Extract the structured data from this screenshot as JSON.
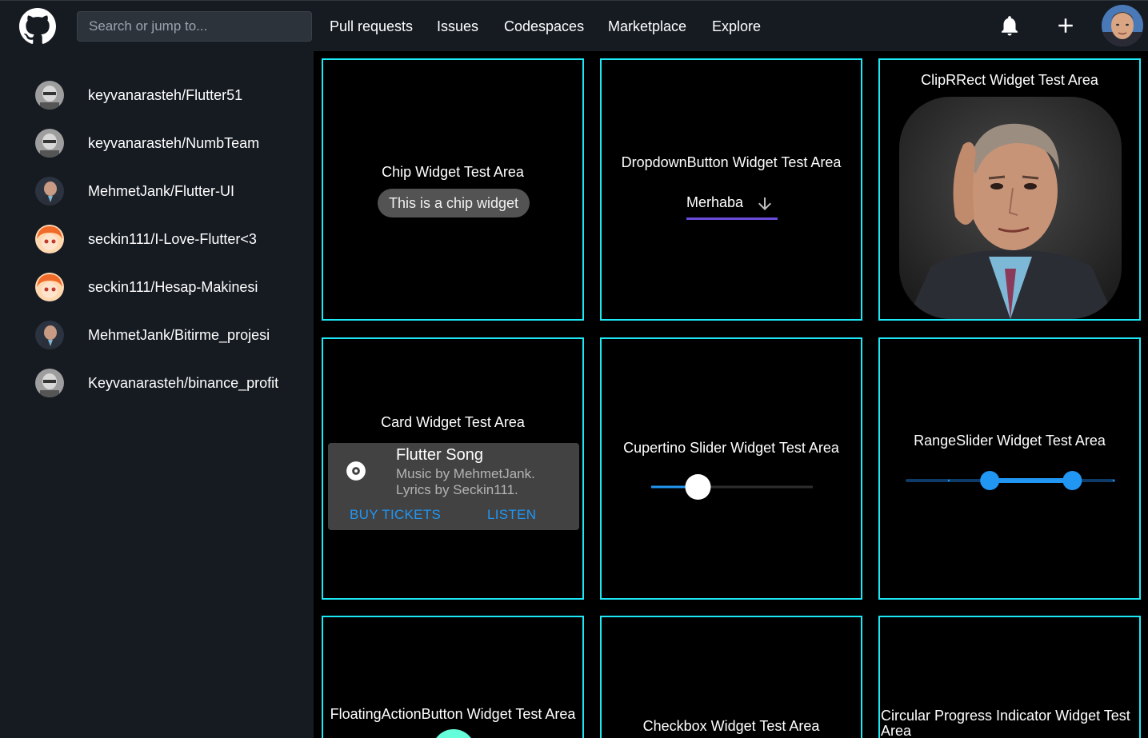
{
  "header": {
    "logo_icon": "github-octocat-icon",
    "search_placeholder": "Search or jump to...",
    "nav": [
      "Pull requests",
      "Issues",
      "Codespaces",
      "Marketplace",
      "Explore"
    ],
    "notification_icon": "bell-icon",
    "add_icon": "plus-icon",
    "avatar": "user-avatar"
  },
  "sidebar": {
    "repos": [
      {
        "name": "keyvanarasteh/Flutter51",
        "avatar": "avatar-grey"
      },
      {
        "name": "keyvanarasteh/NumbTeam",
        "avatar": "avatar-grey"
      },
      {
        "name": "MehmetJank/Flutter-UI",
        "avatar": "avatar-suit"
      },
      {
        "name": "seckin111/I-Love-Flutter<3",
        "avatar": "avatar-anime"
      },
      {
        "name": "seckin111/Hesap-Makinesi",
        "avatar": "avatar-anime"
      },
      {
        "name": "MehmetJank/Bitirme_projesi",
        "avatar": "avatar-suit"
      },
      {
        "name": "Keyvanarasteh/binance_profit",
        "avatar": "avatar-grey"
      }
    ]
  },
  "tiles": {
    "chip": {
      "title": "Chip Widget Test Area",
      "chip_label": "This is a chip widget"
    },
    "dropdown": {
      "title": "DropdownButton Widget Test Area",
      "value": "Merhaba",
      "icon": "arrow-down-icon"
    },
    "cliprrect": {
      "title": "ClipRRect Widget Test Area",
      "image": "portrait-photo"
    },
    "card": {
      "title": "Card Widget Test Area",
      "card_title": "Flutter Song",
      "card_line1": "Music by MehmetJank.",
      "card_line2": "Lyrics by Seckin111.",
      "button1": "BUY TICKETS",
      "button2": "LISTEN",
      "icon": "album-icon"
    },
    "cupertino_slider": {
      "title": "Cupertino Slider Widget Test Area",
      "value": 0.25
    },
    "range_slider": {
      "title": "RangeSlider Widget Test Area",
      "start": 0.4,
      "end": 0.8
    },
    "fab": {
      "title": "FloatingActionButton Widget Test Area"
    },
    "checkbox": {
      "title": "Checkbox Widget Test Area"
    },
    "circular": {
      "title": "Circular Progress Indicator Widget Test Area"
    }
  },
  "colors": {
    "tile_border": "#1de9f6",
    "accent_blue": "#2196f3",
    "dropdown_underline": "#6a4cd9"
  }
}
